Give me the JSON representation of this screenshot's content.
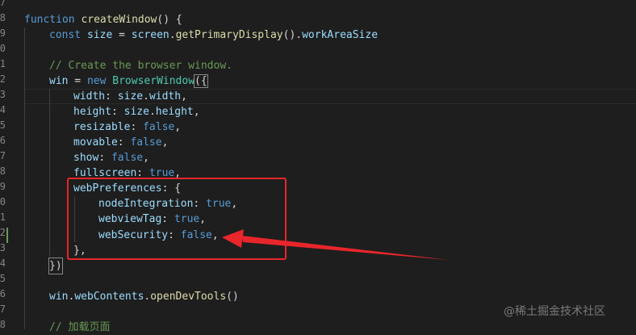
{
  "gutter": {
    "line_numbers": [
      "7",
      "8",
      "9",
      "0",
      "1",
      "2",
      "3",
      "4",
      "5",
      "6",
      "7",
      "8",
      "9",
      "0",
      "1",
      "2",
      "3",
      "4",
      "5",
      "6",
      "7",
      "8"
    ]
  },
  "code": {
    "l1": {
      "kw": "function",
      "fn": "createWindow",
      "rest": "() {"
    },
    "l2": {
      "kw": "const",
      "var": "size",
      "eq": " = ",
      "obj": "screen",
      "dot": ".",
      "fn": "getPrimaryDisplay",
      "paren": "().",
      "prop": "workAreaSize"
    },
    "l4": {
      "comment": "// Create the browser window."
    },
    "l5": {
      "var": "win",
      "eq": " = ",
      "kw": "new",
      "cls": "BrowserWindow",
      "open": "({"
    },
    "l6": {
      "key": "width",
      "colon": ": ",
      "obj": "size",
      "dot": ".",
      "prop": "width",
      "end": ","
    },
    "l7": {
      "key": "height",
      "colon": ": ",
      "obj": "size",
      "dot": ".",
      "prop": "height",
      "end": ","
    },
    "l8": {
      "key": "resizable",
      "colon": ": ",
      "val": "false",
      "end": ","
    },
    "l9": {
      "key": "movable",
      "colon": ": ",
      "val": "false",
      "end": ","
    },
    "l10": {
      "key": "show",
      "colon": ": ",
      "val": "false",
      "end": ","
    },
    "l11": {
      "key": "fullscreen",
      "colon": ": ",
      "val": "true",
      "end": ","
    },
    "l12": {
      "key": "webPreferences",
      "colon": ": ",
      "end": "{"
    },
    "l13": {
      "key": "nodeIntegration",
      "colon": ": ",
      "val": "true",
      "end": ","
    },
    "l14": {
      "key": "webviewTag",
      "colon": ": ",
      "val": "true",
      "end": ","
    },
    "l15": {
      "key": "webSecurity",
      "colon": ": ",
      "val": "false",
      "end": ","
    },
    "l16": {
      "text": "},"
    },
    "l17": {
      "text": "})"
    },
    "l19": {
      "obj": "win",
      "dot": ".",
      "prop": "webContents",
      "dot2": ".",
      "fn": "openDevTools",
      "rest": "()"
    },
    "l21": {
      "comment": "// 加载页面"
    }
  },
  "watermark": "@稀土掘金技术社区",
  "colors": {
    "highlight": "#e8262b",
    "background": "#1e1e1e"
  }
}
